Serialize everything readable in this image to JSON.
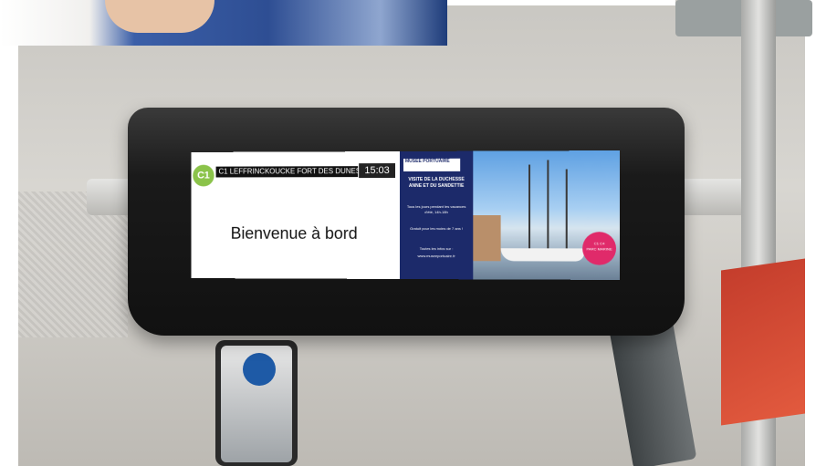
{
  "display": {
    "line": "C1",
    "destination": "C1 LEFFRINCKOUCKE FORT DES DUNES",
    "time": "15:03",
    "welcome": "Bienvenue à bord"
  },
  "ad": {
    "logo": "MUSÉE PORTUAIRE",
    "title": "VISITE DE LA DUCHESSE ANNE ET DU SANDETTIE",
    "line1": "Tous les jours pendant les vacances d'été, 14h-18h",
    "line2": "Gratuit pour les moins de 7 ans !",
    "line3": "Toutes les infos sur :",
    "url": "www.museeportuaire.fr",
    "badge_lines": [
      "C1 C4",
      "PARC MARINE"
    ]
  }
}
